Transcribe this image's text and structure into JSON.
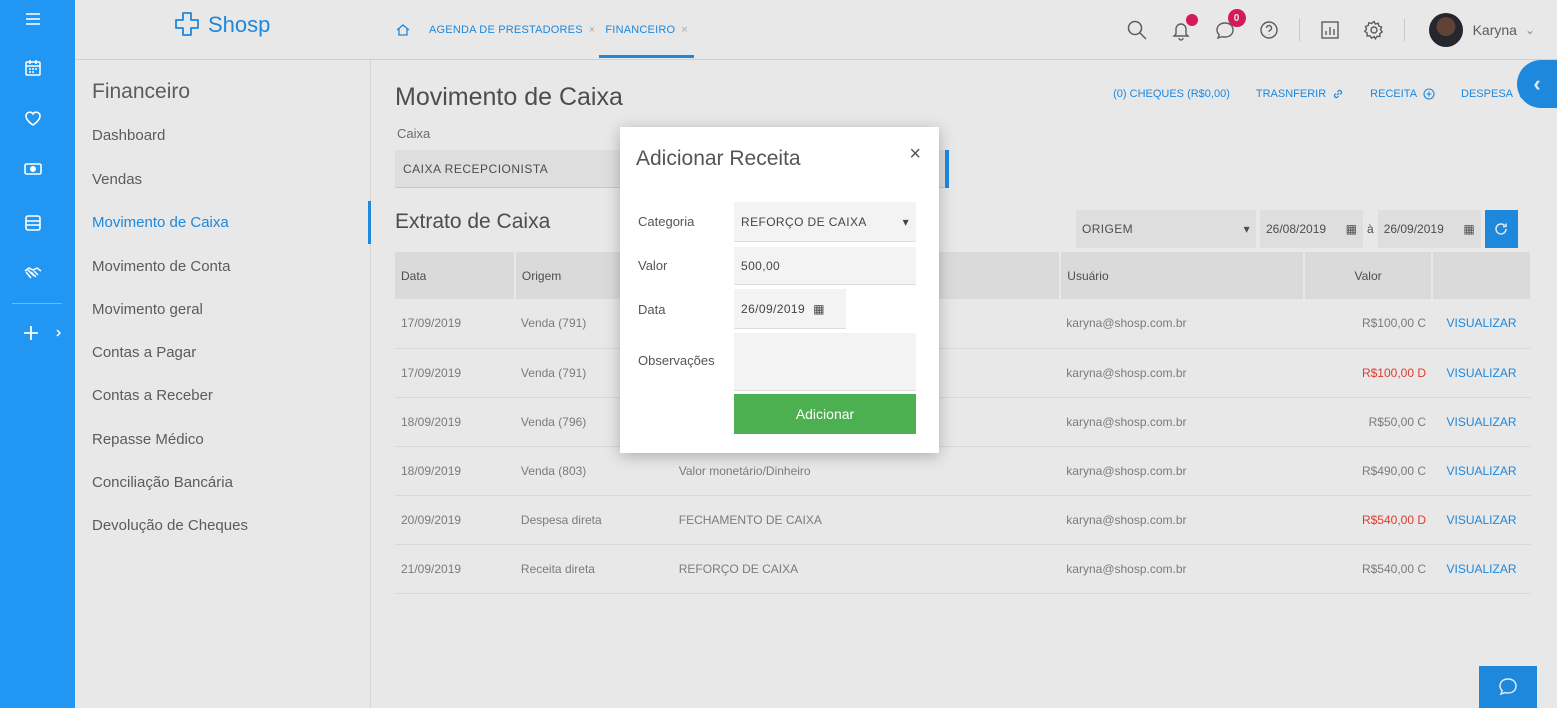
{
  "app": {
    "logo_text": "Shosp",
    "brand_color": "#2196f3"
  },
  "rail": {
    "icons": [
      "menu-icon",
      "calendar-icon",
      "heart-icon",
      "money-icon",
      "list-icon",
      "handshake-icon",
      "plus-icon"
    ]
  },
  "header": {
    "tabs": [
      {
        "label": "AGENDA DE PRESTADORES",
        "close": "×"
      },
      {
        "label": "FINANCEIRO",
        "close": "×"
      }
    ],
    "messages_badge": "0",
    "user_name": "Karyna",
    "user_chevron": "⌄"
  },
  "sidebar": {
    "title": "Financeiro",
    "items": [
      "Dashboard",
      "Vendas",
      "Movimento de Caixa",
      "Movimento de Conta",
      "Movimento geral",
      "Contas a Pagar",
      "Contas a Receber",
      "Repasse Médico",
      "Conciliação Bancária",
      "Devolução de Cheques"
    ]
  },
  "main": {
    "title": "Movimento de Caixa",
    "links": {
      "cheques": "(0) CHEQUES (R$0,00)",
      "transferir": "TRASNFERIR",
      "receita": "RECEITA",
      "despesa": "DESPESA"
    },
    "caixa_label": "Caixa",
    "caixa_value": "CAIXA RECEPCIONISTA",
    "extrato_title": "Extrato de Caixa",
    "filters": {
      "origem": "ORIGEM",
      "date_from": "26/08/2019",
      "to": "à",
      "date_to": "26/09/2019"
    },
    "table": {
      "headers": [
        "Data",
        "Origem",
        "",
        "Usuário",
        "Valor",
        ""
      ],
      "rows": [
        {
          "data": "17/09/2019",
          "origem": "Venda (791)",
          "desc": "",
          "usuario": "karyna@shosp.com.br",
          "valor": "R$100,00 C",
          "neg": false,
          "acao": "VISUALIZAR"
        },
        {
          "data": "17/09/2019",
          "origem": "Venda (791)",
          "desc": "",
          "usuario": "karyna@shosp.com.br",
          "valor": "R$100,00 D",
          "neg": true,
          "acao": "VISUALIZAR"
        },
        {
          "data": "18/09/2019",
          "origem": "Venda (796)",
          "desc": "",
          "usuario": "karyna@shosp.com.br",
          "valor": "R$50,00 C",
          "neg": false,
          "acao": "VISUALIZAR"
        },
        {
          "data": "18/09/2019",
          "origem": "Venda (803)",
          "desc": "Valor monetário/Dinheiro",
          "usuario": "karyna@shosp.com.br",
          "valor": "R$490,00 C",
          "neg": false,
          "acao": "VISUALIZAR"
        },
        {
          "data": "20/09/2019",
          "origem": "Despesa direta",
          "desc": "FECHAMENTO DE CAIXA",
          "usuario": "karyna@shosp.com.br",
          "valor": "R$540,00 D",
          "neg": true,
          "acao": "VISUALIZAR"
        },
        {
          "data": "21/09/2019",
          "origem": "Receita direta",
          "desc": "REFORÇO DE CAIXA",
          "usuario": "karyna@shosp.com.br",
          "valor": "R$540,00 C",
          "neg": false,
          "acao": "VISUALIZAR"
        }
      ]
    }
  },
  "modal": {
    "title": "Adicionar Receita",
    "close": "×",
    "categoria_label": "Categoria",
    "categoria_value": "REFORÇO DE CAIXA",
    "valor_label": "Valor",
    "valor_value": "500,00",
    "data_label": "Data",
    "data_value": "26/09/2019",
    "obs_label": "Observações",
    "obs_value": "",
    "submit_label": "Adicionar",
    "submit_color": "#4caf50"
  },
  "colors": {
    "negative": "#f44336",
    "badge": "#e91e63"
  }
}
